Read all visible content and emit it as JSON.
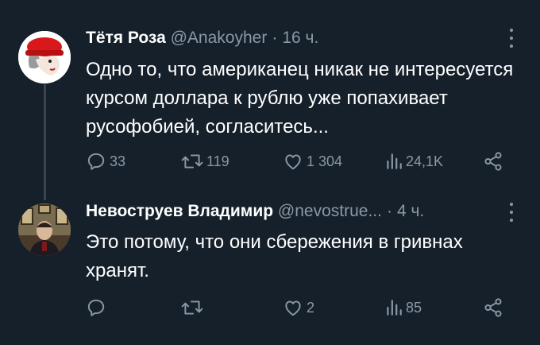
{
  "tweets": [
    {
      "author_name": "Тётя Роза",
      "handle": "@Anakoyher",
      "separator": "·",
      "time": "16 ч.",
      "text": "Одно то, что американец никак не интересуется курсом доллара к рублю уже попахивает русофобией, согласитесь...",
      "replies": "33",
      "retweets": "119",
      "likes": "1 304",
      "views": "24,1K"
    },
    {
      "author_name": "Невоструев Владимир",
      "handle": "@nevostrue...",
      "separator": "·",
      "time": "4 ч.",
      "text": "Это потому, что они сбережения в гривнах хранят.",
      "replies": "",
      "retweets": "",
      "likes": "2",
      "views": "85"
    }
  ],
  "colors": {
    "background": "#15202b",
    "text": "#ffffff",
    "secondary": "#8b98a5",
    "thread_line": "#38444d"
  },
  "icons": [
    "reply-icon",
    "retweet-icon",
    "like-icon",
    "views-icon",
    "share-icon",
    "more-icon"
  ]
}
